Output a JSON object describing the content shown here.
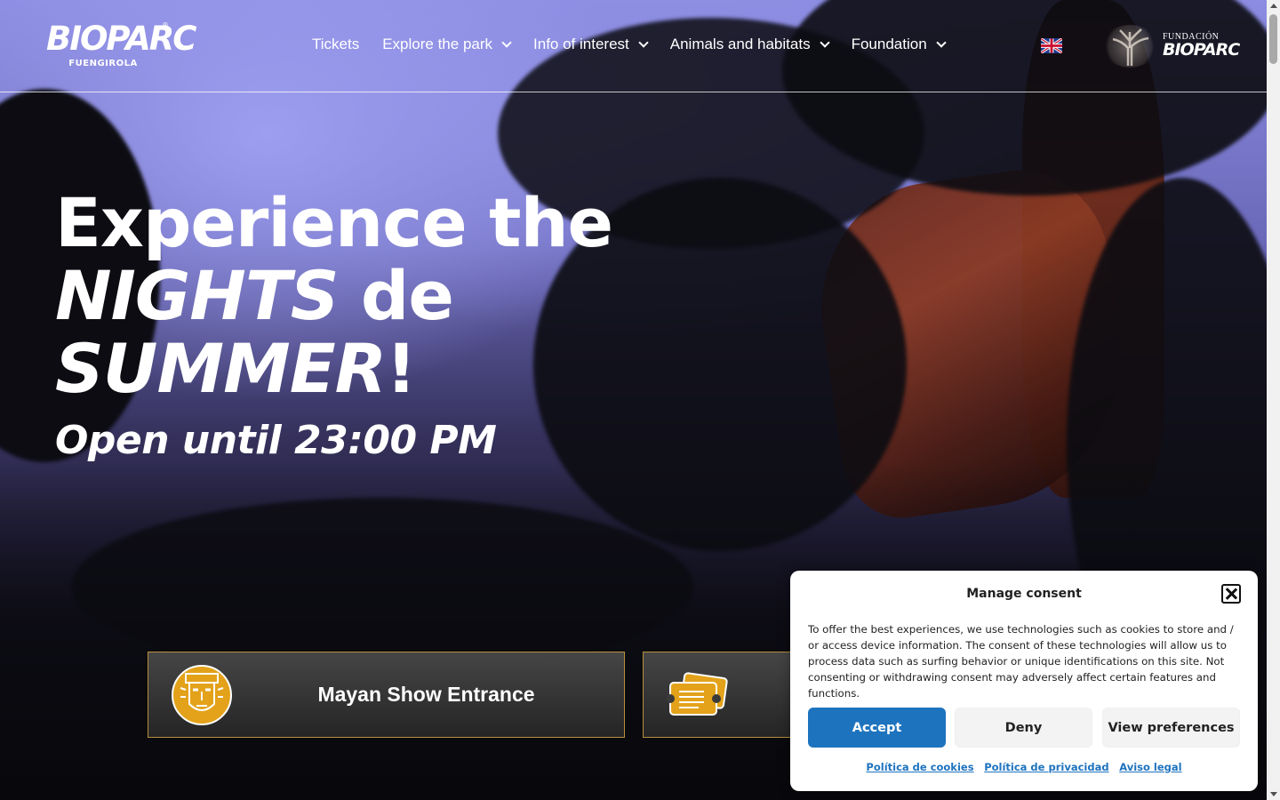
{
  "logo": {
    "word": "BIOPARC",
    "sub": "FUENGIROLA",
    "reg": "®"
  },
  "nav": {
    "items": [
      {
        "label": "Tickets",
        "dropdown": false
      },
      {
        "label": "Explore the park",
        "dropdown": true
      },
      {
        "label": "Info of interest",
        "dropdown": true
      },
      {
        "label": "Animals and habitats",
        "dropdown": true
      },
      {
        "label": "Foundation",
        "dropdown": true
      }
    ],
    "language_flag": "uk-flag-icon"
  },
  "foundation_logo": {
    "line1": "FUNDACIÓN",
    "line2": "BIOPARC"
  },
  "hero": {
    "line1": "Experience the",
    "line2_em": "NIGHTS",
    "line2_rest": " de",
    "line3_em": "SUMMER",
    "line3_rest": "!",
    "subline": "Open until 23:00 PM"
  },
  "cards": [
    {
      "title": "Mayan Show Entrance",
      "icon": "mayan-mask-icon"
    },
    {
      "title": "",
      "icon": "ticket-icon"
    }
  ],
  "consent": {
    "title": "Manage consent",
    "text": "To offer the best experiences, we use technologies such as cookies to store and / or access device information. The consent of these technologies will allow us to process data such as surfing behavior or unique identifications on this site. Not consenting or withdrawing consent may adversely affect certain features and functions.",
    "accept": "Accept",
    "deny": "Deny",
    "preferences": "View preferences",
    "links": [
      "Política de cookies",
      "Política de privacidad",
      "Aviso legal"
    ]
  },
  "colors": {
    "accent": "#1e73be",
    "card_border": "#b8903a",
    "icon_gold": "#e3a21a"
  }
}
